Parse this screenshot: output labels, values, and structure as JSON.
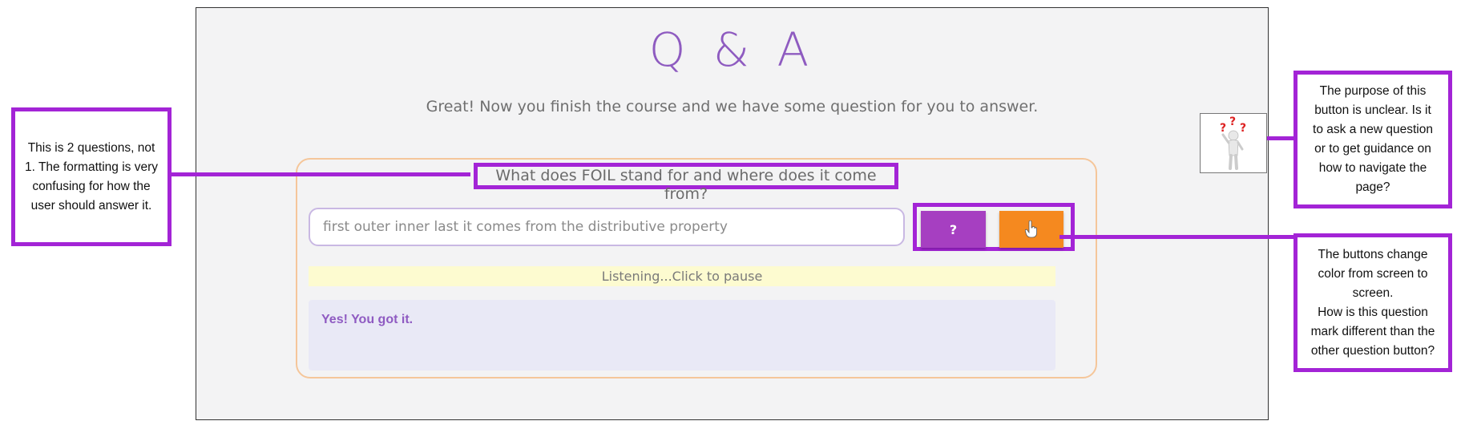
{
  "page": {
    "title": "Q & A",
    "subtitle": "Great! Now you finish the course and we have some question for you to answer."
  },
  "qa": {
    "question": "What does FOIL stand for and where does it come from?",
    "answer_value": "first outer inner last it comes from the distributive property",
    "question_button_label": "?",
    "mic_button_icon": "hand-pointer-icon",
    "listening_status": "Listening...Click to pause",
    "feedback": "Yes! You got it."
  },
  "help_button": {
    "icon": "question-person-icon"
  },
  "annotations": {
    "left": "This is 2 questions, not\n1. The formatting is very\nconfusing for how the\nuser should answer it.",
    "right_top": "The purpose of this\nbutton is unclear.  Is it\nto ask a new question\nor to get guidance on\nhow to navigate the\npage?",
    "right_bottom": "The buttons change\ncolor from screen to\nscreen.\nHow is this question\nmark different than the\nother question button?"
  },
  "colors": {
    "annotation_border": "#a324d6",
    "title": "#8e5bc0",
    "question_button": "#a63fc1",
    "mic_button": "#f5891f",
    "listening_bg": "#fdfbd0",
    "feedback_bg": "#e9e9f6"
  }
}
